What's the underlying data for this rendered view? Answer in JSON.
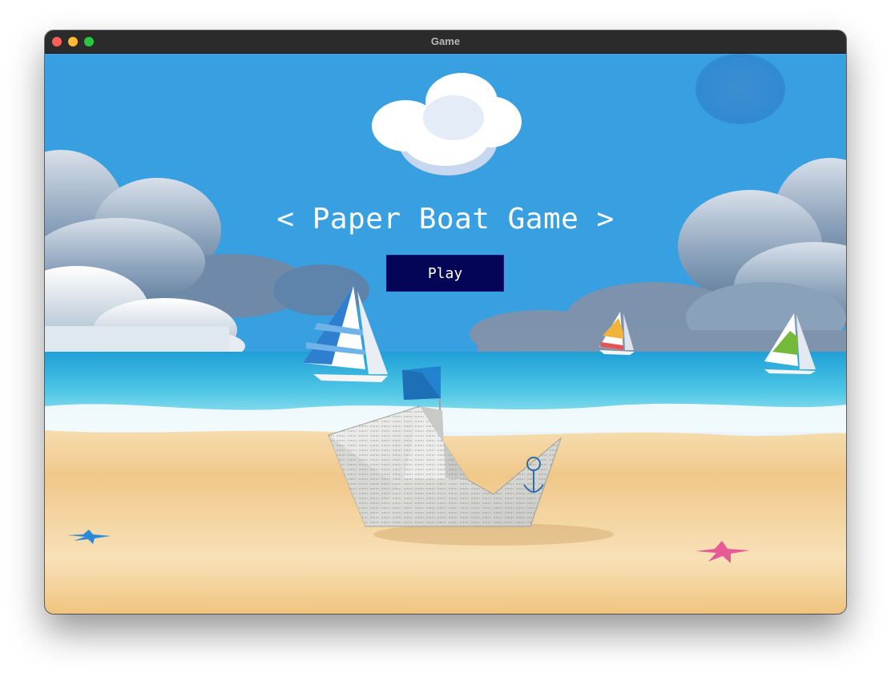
{
  "window": {
    "title": "Game"
  },
  "game": {
    "title": "< Paper Boat Game >",
    "play_label": "Play"
  },
  "colors": {
    "sky": "#3a9be0",
    "button_bg": "#050558",
    "sand": "#f3d39a"
  }
}
